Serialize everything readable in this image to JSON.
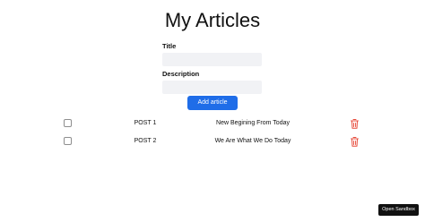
{
  "page": {
    "title": "My Articles"
  },
  "form": {
    "title_label": "Title",
    "title_value": "",
    "description_label": "Description",
    "description_value": "",
    "submit_label": "Add article"
  },
  "articles": [
    {
      "title": "POST 1",
      "description": "New Begining From Today",
      "checked": false
    },
    {
      "title": "POST 2",
      "description": "We Are What We Do Today",
      "checked": false
    }
  ],
  "icons": {
    "delete": "trash-icon"
  },
  "colors": {
    "primary": "#1f6de8",
    "delete": "#e74c3c",
    "input_bg": "#f1f2f5",
    "sandbox_bg": "#111111"
  },
  "sandbox": {
    "label": "Open Sandbox"
  }
}
